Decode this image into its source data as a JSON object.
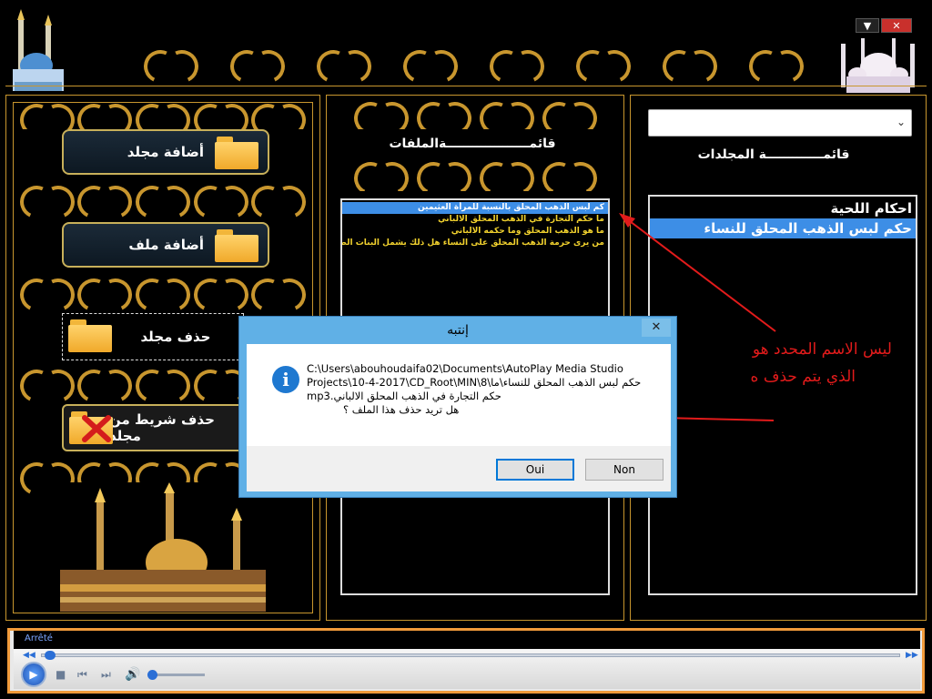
{
  "window": {
    "controls": {
      "minimize_glyph": "▼",
      "close_glyph": "✕"
    }
  },
  "left_panel": {
    "buttons": [
      {
        "label": "أضافة مجلد"
      },
      {
        "label": "أضافة ملف"
      },
      {
        "label": "حذف مجلد"
      },
      {
        "label": "حذف  شريط من مجلد"
      }
    ]
  },
  "files_panel": {
    "title": "قائمـــــــــــــــــــةالملفات",
    "items": [
      "كم لبس الذهب المحلق بالنسبة للمرأة العثيمين",
      "ما حكم التجارة في الذهب المحلق الالباني",
      "ما هو الذهب المحلق  وما حكمه الالباني",
      "من يرى حرمة الذهب المحلق على النساء هل ذلك يشمل البنات الصغ"
    ],
    "selected_index": 0
  },
  "folders_panel": {
    "dropdown_value": "",
    "title": "قائمـــــــــــــة المجلدات",
    "items": [
      "احكام اللحية",
      "حكم  لبس الذهب المحلق للنساء"
    ],
    "selected_index": 1
  },
  "dialog": {
    "title": "إنتبه",
    "close_glyph": "✕",
    "lines": [
      "C:\\Users\\abouhoudaifa02\\Documents\\AutoPlay Media Studio",
      "حكم  لبس الذهب المحلق للنساء\\ما\\8\\Projects\\10-4-2017\\CD_Root\\MIN",
      "حكم التجارة في الذهب المحلق الالباني.mp3",
      "هل تريد حذف هذا الملف ؟"
    ],
    "buttons": {
      "yes": "Oui",
      "no": "Non"
    }
  },
  "annotation": {
    "line1": "ليس الاسم المحدد هو",
    "line2": "الذي يتم حذف ه"
  },
  "media_player": {
    "status": "Arrêté",
    "seek_fraction": 0.0,
    "volume_fraction": 0.05
  },
  "colors": {
    "gold": "#c8962e",
    "selection": "#3d8ee6",
    "annotation": "#e21b1b",
    "dialog_frame": "#60b0e6",
    "media_border": "#f19a3a"
  }
}
